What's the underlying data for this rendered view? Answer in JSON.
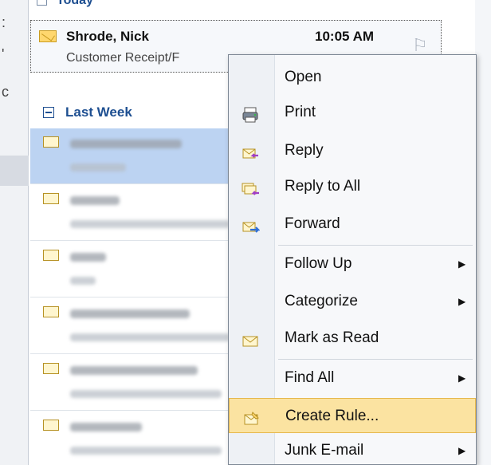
{
  "today_header": "Today",
  "selected_message": {
    "sender": "Shrode, Nick",
    "time": "10:05 AM",
    "subject": "Customer Receipt/F"
  },
  "group_header": "Last Week",
  "blurred_rows": [
    {
      "name": "blurred-row-1"
    },
    {
      "name": "blurred-row-2"
    },
    {
      "name": "blurred-row-3"
    },
    {
      "name": "blurred-row-4"
    },
    {
      "name": "blurred-row-5"
    },
    {
      "name": "blurred-row-6"
    }
  ],
  "context_menu": {
    "items": [
      {
        "label": "Open",
        "icon": "none",
        "submenu": false
      },
      {
        "label": "Print",
        "icon": "printer-icon",
        "submenu": false
      },
      {
        "label": "Reply",
        "icon": "reply-icon",
        "submenu": false
      },
      {
        "label": "Reply to All",
        "icon": "reply-all-icon",
        "submenu": false
      },
      {
        "label": "Forward",
        "icon": "forward-icon",
        "submenu": false
      },
      {
        "label": "Follow Up",
        "icon": "none",
        "submenu": true
      },
      {
        "label": "Categorize",
        "icon": "none",
        "submenu": true
      },
      {
        "label": "Mark as Read",
        "icon": "envelope-open-icon",
        "submenu": false
      },
      {
        "label": "Find All",
        "icon": "none",
        "submenu": true
      },
      {
        "label": "Create Rule...",
        "icon": "rule-icon",
        "submenu": false
      },
      {
        "label": "Junk E-mail",
        "icon": "none",
        "submenu": true
      }
    ]
  },
  "colors": {
    "highlight": "#fbe3a1",
    "selected_row": "#bcd3f2",
    "header_blue": "#1e4f91"
  }
}
